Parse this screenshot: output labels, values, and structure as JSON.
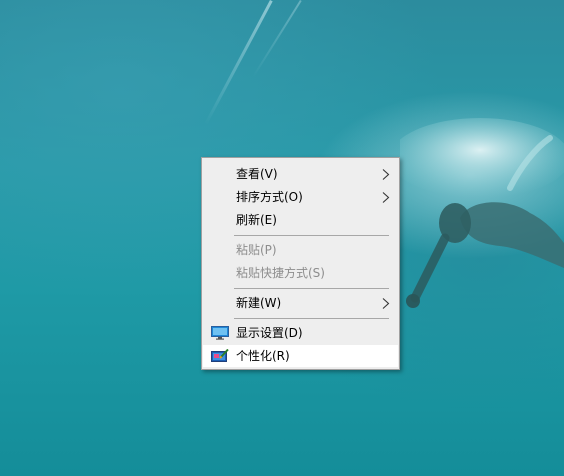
{
  "desktop": {
    "wallpaper": "underwater swimmer",
    "colors": {
      "water": "#1f9aa6",
      "menu_bg": "#eeeeee",
      "menu_hover": "#ffffff",
      "disabled_text": "#8d8d8d"
    }
  },
  "context_menu": {
    "items": [
      {
        "label": "查看(V)",
        "enabled": true,
        "submenu": true
      },
      {
        "label": "排序方式(O)",
        "enabled": true,
        "submenu": true
      },
      {
        "label": "刷新(E)",
        "enabled": true,
        "submenu": false
      },
      {
        "label": "粘贴(P)",
        "enabled": false,
        "submenu": false
      },
      {
        "label": "粘贴快捷方式(S)",
        "enabled": false,
        "submenu": false
      },
      {
        "label": "新建(W)",
        "enabled": true,
        "submenu": true
      },
      {
        "label": "显示设置(D)",
        "enabled": true,
        "submenu": false,
        "icon": "monitor-icon"
      },
      {
        "label": "个性化(R)",
        "enabled": true,
        "submenu": false,
        "icon": "personalize-icon",
        "highlighted": true
      }
    ]
  }
}
